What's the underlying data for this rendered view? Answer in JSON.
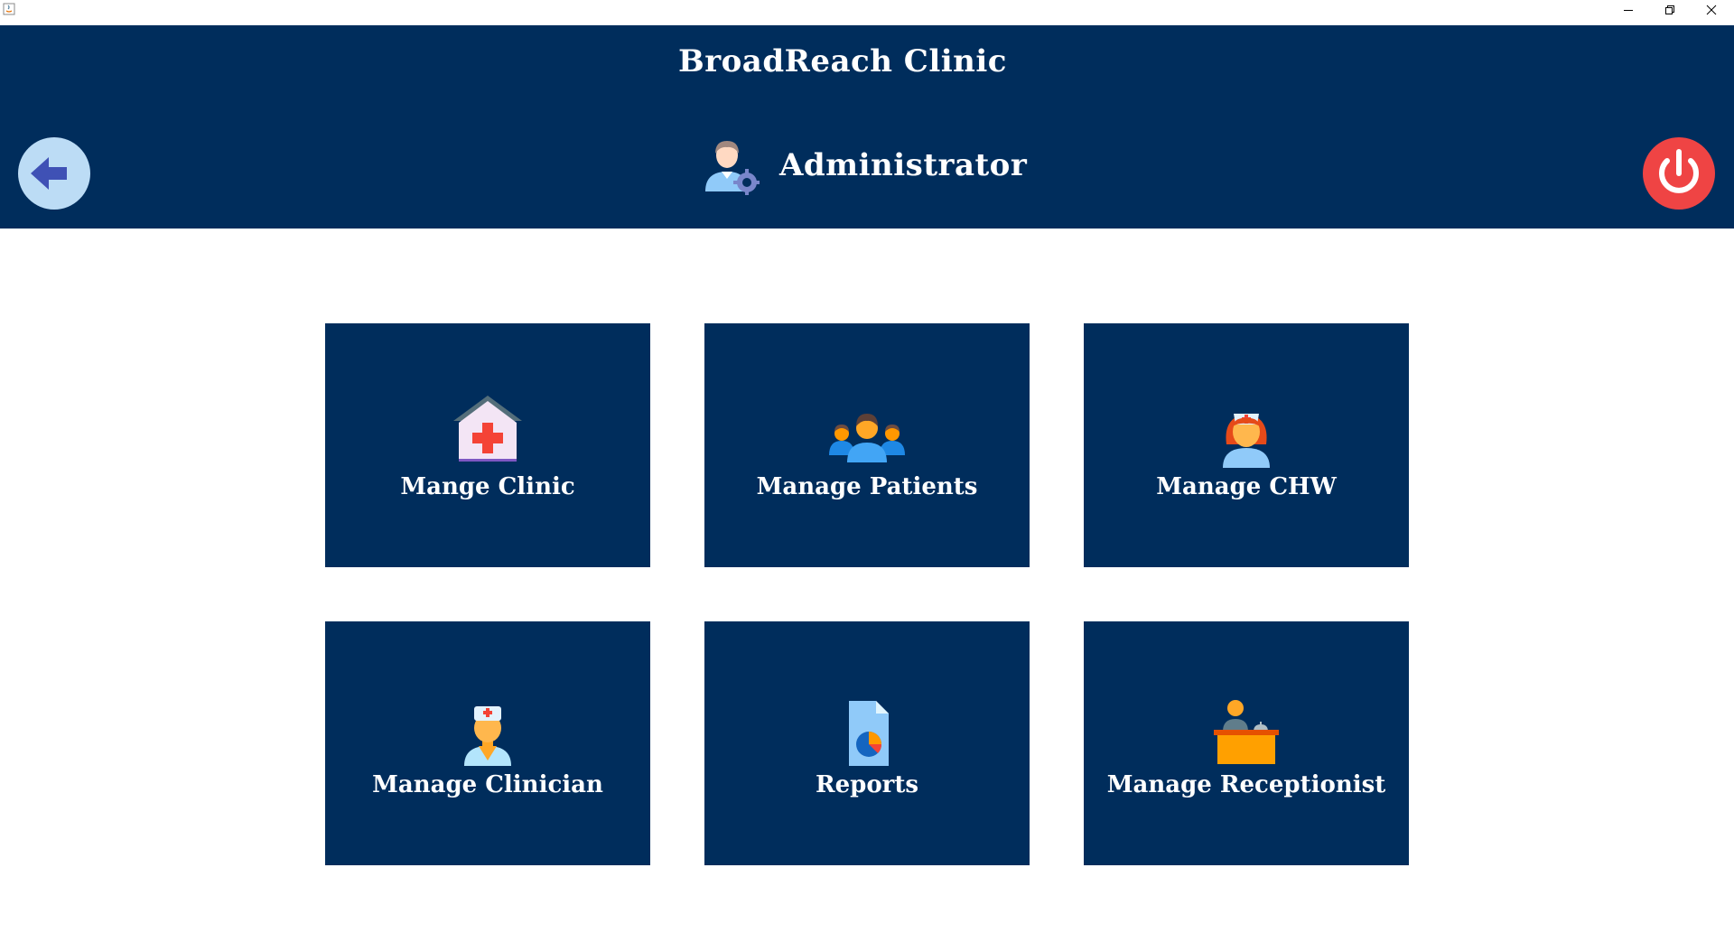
{
  "window": {
    "icon": "java-app-icon",
    "controls": [
      "minimize-icon",
      "restore-icon",
      "close-icon"
    ]
  },
  "header": {
    "app_title": "BroadReach Clinic",
    "role_title": "Administrator",
    "role_icon": "admin-user-gear-icon",
    "back_icon": "back-arrow-icon",
    "power_icon": "power-icon",
    "colors": {
      "background": "#002d5c",
      "back_button": "#bcdcf5",
      "power_button": "#ef4444"
    }
  },
  "tiles": [
    {
      "label": "Mange Clinic",
      "icon": "clinic-building-icon"
    },
    {
      "label": "Manage Patients",
      "icon": "patients-group-icon"
    },
    {
      "label": "Manage CHW",
      "icon": "nurse-icon"
    },
    {
      "label": "Manage Clinician",
      "icon": "doctor-icon"
    },
    {
      "label": "Reports",
      "icon": "report-document-icon"
    },
    {
      "label": "Manage Receptionist",
      "icon": "receptionist-desk-icon"
    }
  ],
  "colors": {
    "tile_background": "#002d5c",
    "page_background": "#ffffff"
  }
}
